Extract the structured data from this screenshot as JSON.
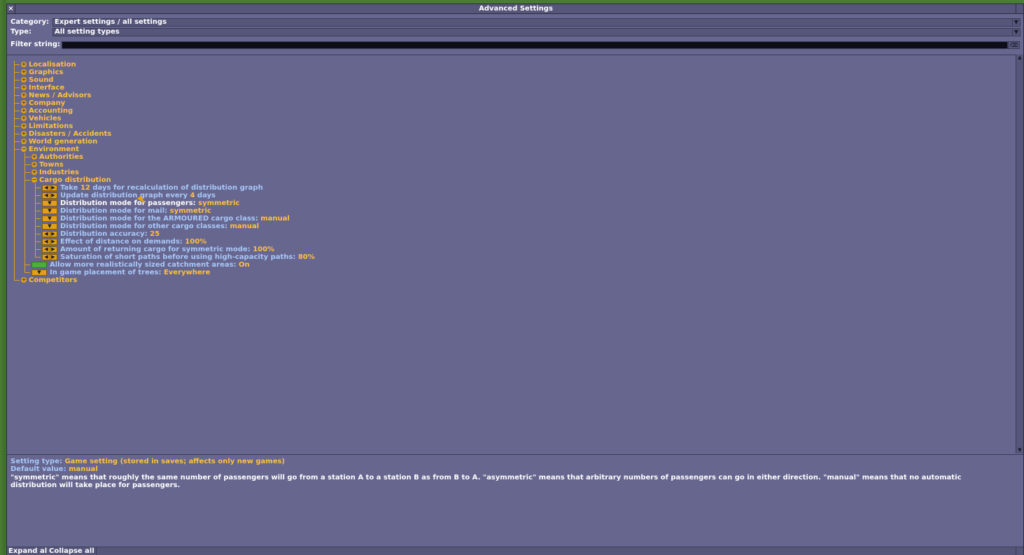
{
  "window": {
    "title": "Advanced Settings",
    "close_icon": "×"
  },
  "filters": {
    "category_label": "Category:",
    "category_value": "Expert settings / all settings",
    "type_label": "Type:",
    "type_value": "All setting types",
    "filter_label": "Filter string:",
    "filter_value": ""
  },
  "tree": {
    "top_categories": [
      "Localisation",
      "Graphics",
      "Sound",
      "Interface",
      "News / Advisors",
      "Company",
      "Accounting",
      "Vehicles",
      "Limitations",
      "Disasters / Accidents",
      "World generation"
    ],
    "environment": {
      "label": "Environment",
      "subcategories": [
        "Authorities",
        "Towns",
        "Industries"
      ],
      "cargo": {
        "label": "Cargo distribution",
        "settings": [
          {
            "name": "Take ",
            "value": "12",
            "suffix": " days for recalculation of distribution graph",
            "control": "arrows"
          },
          {
            "name": "Update distribution graph every ",
            "value": "4",
            "suffix": " days",
            "control": "arrows"
          },
          {
            "name": "Distribution mode for passengers: ",
            "value": "symmetric",
            "suffix": "",
            "control": "dropdown"
          },
          {
            "name": "Distribution mode for mail: ",
            "value": "symmetric",
            "suffix": "",
            "control": "dropdown"
          },
          {
            "name": "Distribution mode for the ARMOURED cargo class: ",
            "value": "manual",
            "suffix": "",
            "control": "dropdown"
          },
          {
            "name": "Distribution mode for other cargo classes: ",
            "value": "manual",
            "suffix": "",
            "control": "dropdown"
          },
          {
            "name": "Distribution accuracy: ",
            "value": "25",
            "suffix": "",
            "control": "arrows"
          },
          {
            "name": "Effect of distance on demands: ",
            "value": "100%",
            "suffix": "",
            "control": "arrows"
          },
          {
            "name": "Amount of returning cargo for symmetric mode: ",
            "value": "100%",
            "suffix": "",
            "control": "arrows"
          },
          {
            "name": "Saturation of short paths before using high-capacity paths: ",
            "value": "80%",
            "suffix": "",
            "control": "arrows"
          }
        ]
      },
      "settings": [
        {
          "name": "Allow more realistically sized catchment areas: ",
          "value": "On",
          "control": "toggle"
        },
        {
          "name": "In game placement of trees: ",
          "value": "Everywhere",
          "control": "dropdown"
        }
      ]
    },
    "last_category": "Competitors"
  },
  "description": {
    "type_key": "Setting type: ",
    "type_value": "Game setting (stored in saves; affects only new games)",
    "default_key": "Default value: ",
    "default_value": "manual",
    "text": "\"symmetric\" means that roughly the same number of passengers will go from a station A to a station B as from B to A. \"asymmetric\" means that arbitrary numbers of passengers can go in either direction. \"manual\" means that no automatic distribution will take place for passengers."
  },
  "bottom": {
    "expand_all": "Expand all",
    "collapse_all": "Collapse all"
  },
  "colors": {
    "window_bg": "#66668f",
    "category_text": "#ffc040",
    "setting_text": "#a8c8f8",
    "button_orange": "#e0a018"
  }
}
